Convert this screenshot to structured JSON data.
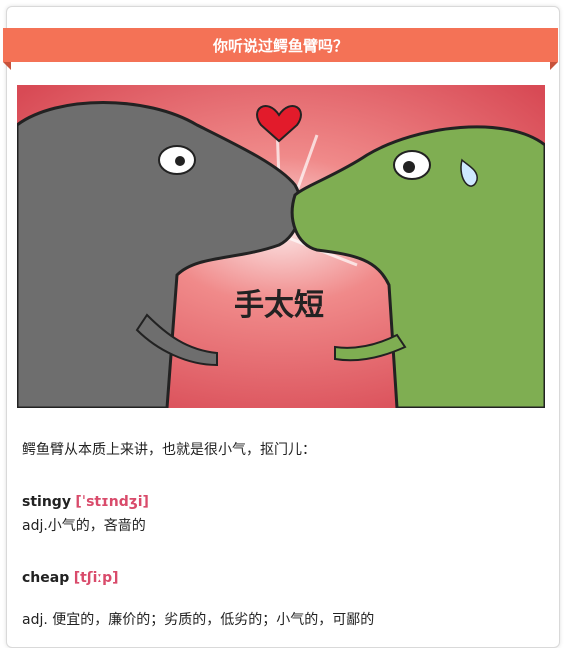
{
  "header": {
    "title": "你听说过鳄鱼臂吗？"
  },
  "illustration": {
    "caption_text": "手太短"
  },
  "article": {
    "intro": "鳄鱼臂从本质上来讲，也就是很小气，抠门儿：",
    "entries": [
      {
        "word": "stingy",
        "ipa": "[ˈstɪndʒi]",
        "definition": "adj.小气的，吝啬的"
      },
      {
        "word": "cheap",
        "ipa": "[tʃiːp]",
        "definition": "adj. 便宜的，廉价的；劣质的，低劣的；小气的，可鄙的"
      }
    ]
  },
  "colors": {
    "ribbon": "#f47256",
    "ipa": "#d94b6b",
    "background": "#e95a5e"
  }
}
